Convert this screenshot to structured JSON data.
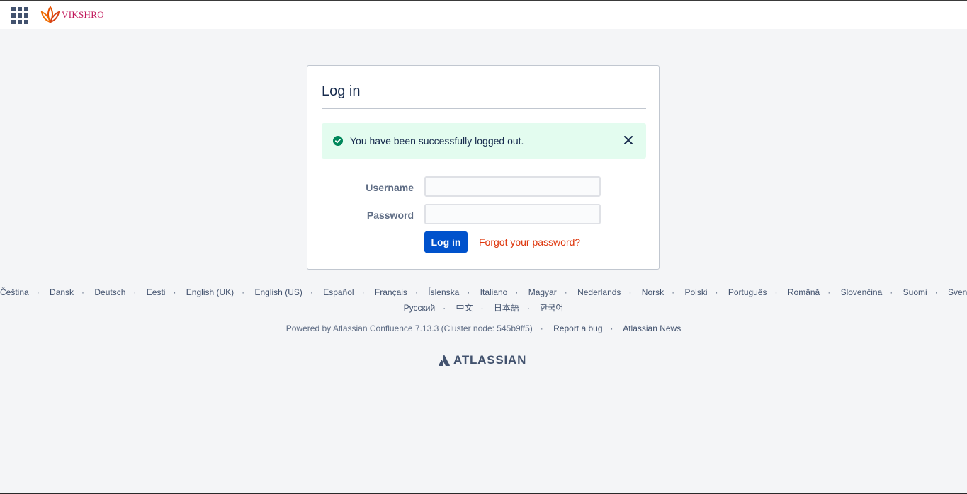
{
  "header": {
    "brand_name": "VIKSHRO"
  },
  "login": {
    "title": "Log in",
    "success_message": "You have been successfully logged out.",
    "username_label": "Username",
    "password_label": "Password",
    "username_value": "",
    "password_value": "",
    "submit_label": "Log in",
    "forgot_label": "Forgot your password?"
  },
  "languages_row1": [
    "Čeština",
    "Dansk",
    "Deutsch",
    "Eesti",
    "English (UK)",
    "English (US)",
    "Español",
    "Français",
    "Íslenska",
    "Italiano",
    "Magyar",
    "Nederlands",
    "Norsk",
    "Polski",
    "Português",
    "Română",
    "Slovenčina",
    "Suomi",
    "Svenska"
  ],
  "languages_row2": [
    "Русский",
    "中文",
    "日本語",
    "한국어"
  ],
  "footer": {
    "powered_by": "Powered by Atlassian Confluence 7.13.3 (Cluster node: 545b9ff5)",
    "report_bug": "Report a bug",
    "news": "Atlassian News",
    "atlassian_brand": "ATLASSIAN"
  },
  "colors": {
    "primary": "#0052cc",
    "success_bg": "#e3fcef",
    "success_icon": "#00875a",
    "link_red": "#de350b"
  }
}
